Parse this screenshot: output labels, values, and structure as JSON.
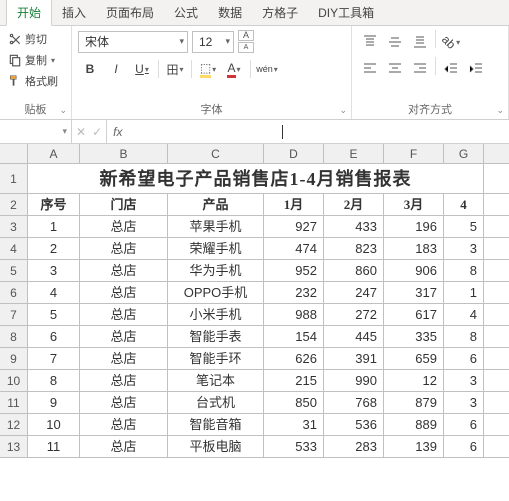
{
  "tabs": [
    "开始",
    "插入",
    "页面布局",
    "公式",
    "数据",
    "方格子",
    "DIY工具箱"
  ],
  "active_tab": 0,
  "ribbon": {
    "clipboard": {
      "cut": "剪切",
      "copy": "复制",
      "format": "格式刷",
      "label": "贴板",
      "launcher": "⌄"
    },
    "font": {
      "name": "宋体",
      "size": "12",
      "inc": "A",
      "dec": "A",
      "bold": "B",
      "italic": "I",
      "underline": "U",
      "border": "田",
      "fill": "⬚",
      "color": "A",
      "phonetic": "wén",
      "label": "字体",
      "launcher": "⌄"
    },
    "align": {
      "label": "对齐方式",
      "launcher": "⌄"
    }
  },
  "formula_bar": {
    "name_box": "",
    "fx": "fx",
    "value": ""
  },
  "cols": [
    "A",
    "B",
    "C",
    "D",
    "E",
    "F",
    "G"
  ],
  "row_nums": [
    "1",
    "2",
    "3",
    "4",
    "5",
    "6",
    "7",
    "8",
    "9",
    "10",
    "11",
    "12",
    "13"
  ],
  "title_text": "新希望电子产品销售店1-4月销售报表",
  "headers": [
    "序号",
    "门店",
    "产品",
    "1月",
    "2月",
    "3月",
    "4"
  ],
  "rows": [
    [
      "1",
      "总店",
      "苹果手机",
      "927",
      "433",
      "196",
      "5"
    ],
    [
      "2",
      "总店",
      "荣耀手机",
      "474",
      "823",
      "183",
      "3"
    ],
    [
      "3",
      "总店",
      "华为手机",
      "952",
      "860",
      "906",
      "8"
    ],
    [
      "4",
      "总店",
      "OPPO手机",
      "232",
      "247",
      "317",
      "1"
    ],
    [
      "5",
      "总店",
      "小米手机",
      "988",
      "272",
      "617",
      "4"
    ],
    [
      "6",
      "总店",
      "智能手表",
      "154",
      "445",
      "335",
      "8"
    ],
    [
      "7",
      "总店",
      "智能手环",
      "626",
      "391",
      "659",
      "6"
    ],
    [
      "8",
      "总店",
      "笔记本",
      "215",
      "990",
      "12",
      "3"
    ],
    [
      "9",
      "总店",
      "台式机",
      "850",
      "768",
      "879",
      "3"
    ],
    [
      "10",
      "总店",
      "智能音箱",
      "31",
      "536",
      "889",
      "6"
    ],
    [
      "11",
      "总店",
      "平板电脑",
      "533",
      "283",
      "139",
      "6"
    ]
  ],
  "chart_data": {
    "type": "table",
    "title": "新希望电子产品销售店1-4月销售报表",
    "columns": [
      "序号",
      "门店",
      "产品",
      "1月",
      "2月",
      "3月"
    ],
    "rows": [
      [
        1,
        "总店",
        "苹果手机",
        927,
        433,
        196
      ],
      [
        2,
        "总店",
        "荣耀手机",
        474,
        823,
        183
      ],
      [
        3,
        "总店",
        "华为手机",
        952,
        860,
        906
      ],
      [
        4,
        "总店",
        "OPPO手机",
        232,
        247,
        317
      ],
      [
        5,
        "总店",
        "小米手机",
        988,
        272,
        617
      ],
      [
        6,
        "总店",
        "智能手表",
        154,
        445,
        335
      ],
      [
        7,
        "总店",
        "智能手环",
        626,
        391,
        659
      ],
      [
        8,
        "总店",
        "笔记本",
        215,
        990,
        12
      ],
      [
        9,
        "总店",
        "台式机",
        850,
        768,
        879
      ],
      [
        10,
        "总店",
        "智能音箱",
        31,
        536,
        889
      ],
      [
        11,
        "总店",
        "平板电脑",
        533,
        283,
        139
      ]
    ]
  }
}
